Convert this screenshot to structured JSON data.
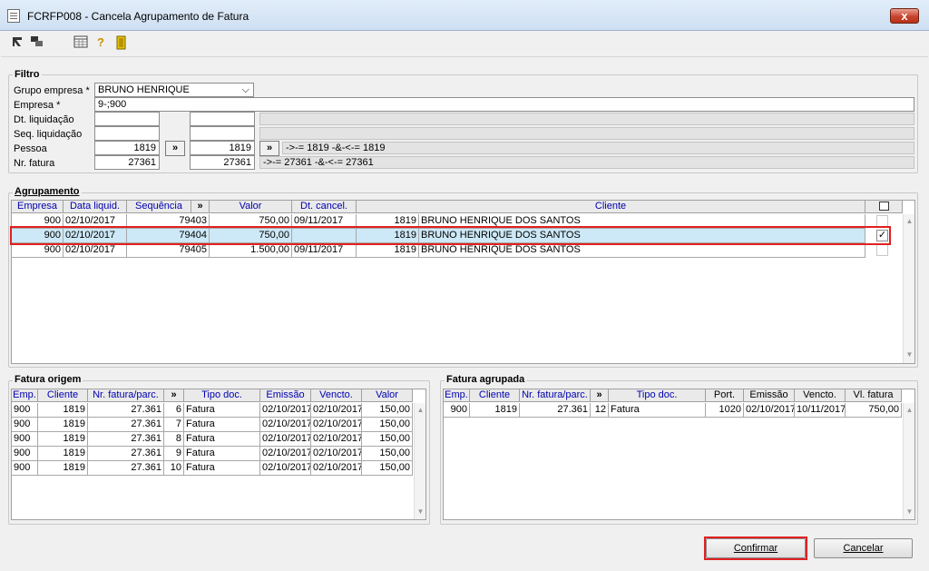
{
  "window": {
    "title": "FCRFP008 - Cancela Agrupamento de Fatura",
    "close_label": "x"
  },
  "toolbar": {
    "icons": [
      "first-icon",
      "navigate-icon",
      "calendar-grid-icon",
      "help-icon",
      "exit-door-icon"
    ],
    "help_glyph": "?"
  },
  "filtro": {
    "title": "Filtro",
    "grupo_label": "Grupo empresa *",
    "grupo_value": "BRUNO HENRIQUE",
    "empresa_label": "Empresa *",
    "empresa_value": "9-;900",
    "dt_label": "Dt. liquidação",
    "seq_label": "Seq. liquidação",
    "pessoa_label": "Pessoa",
    "pessoa_from": "1819",
    "pessoa_to": "1819",
    "pessoa_expr": "->-= 1819 -&-<-= 1819",
    "nr_label": "Nr. fatura",
    "nr_from": "27361",
    "nr_to": "27361",
    "nr_expr": "->-= 27361 -&-<-= 27361",
    "arrow_label": "»"
  },
  "agrupamento": {
    "title": "Agrupamento",
    "headers": [
      "Empresa",
      "Data liquid.",
      "Sequência",
      "»",
      "Valor",
      "Dt. cancel.",
      "Cliente"
    ],
    "rows": [
      {
        "empresa": "900",
        "data": "02/10/2017",
        "seq": "79403",
        "valor": "750,00",
        "dtcancel": "09/11/2017",
        "cli_cod": "1819",
        "cli_nome": "BRUNO HENRIQUE DOS SANTOS",
        "checked": false
      },
      {
        "empresa": "900",
        "data": "02/10/2017",
        "seq": "79404",
        "valor": "750,00",
        "dtcancel": "",
        "cli_cod": "1819",
        "cli_nome": "BRUNO HENRIQUE DOS SANTOS",
        "checked": true
      },
      {
        "empresa": "900",
        "data": "02/10/2017",
        "seq": "79405",
        "valor": "1.500,00",
        "dtcancel": "09/11/2017",
        "cli_cod": "1819",
        "cli_nome": "BRUNO HENRIQUE DOS SANTOS",
        "checked": false
      }
    ],
    "check_mark": "✓"
  },
  "origem": {
    "title": "Fatura origem",
    "headers": [
      "Emp.",
      "Cliente",
      "Nr. fatura/parc.",
      "»",
      "Tipo doc.",
      "Emissão",
      "Vencto.",
      "Valor"
    ],
    "rows": [
      {
        "emp": "900",
        "cliente": "1819",
        "nr": "27.361",
        "parc": "6",
        "tipo": "Fatura",
        "emissao": "02/10/2017",
        "vencto": "02/10/2017",
        "valor": "150,00"
      },
      {
        "emp": "900",
        "cliente": "1819",
        "nr": "27.361",
        "parc": "7",
        "tipo": "Fatura",
        "emissao": "02/10/2017",
        "vencto": "02/10/2017",
        "valor": "150,00"
      },
      {
        "emp": "900",
        "cliente": "1819",
        "nr": "27.361",
        "parc": "8",
        "tipo": "Fatura",
        "emissao": "02/10/2017",
        "vencto": "02/10/2017",
        "valor": "150,00"
      },
      {
        "emp": "900",
        "cliente": "1819",
        "nr": "27.361",
        "parc": "9",
        "tipo": "Fatura",
        "emissao": "02/10/2017",
        "vencto": "02/10/2017",
        "valor": "150,00"
      },
      {
        "emp": "900",
        "cliente": "1819",
        "nr": "27.361",
        "parc": "10",
        "tipo": "Fatura",
        "emissao": "02/10/2017",
        "vencto": "02/10/2017",
        "valor": "150,00"
      }
    ]
  },
  "agrupada": {
    "title": "Fatura agrupada",
    "headers": [
      "Emp.",
      "Cliente",
      "Nr. fatura/parc.",
      "»",
      "Tipo doc.",
      "Port.",
      "Emissão",
      "Vencto.",
      "Vl. fatura"
    ],
    "rows": [
      {
        "emp": "900",
        "cliente": "1819",
        "nr": "27.361",
        "parc": "12",
        "tipo": "Fatura",
        "port": "1020",
        "emissao": "02/10/2017",
        "vencto": "10/11/2017",
        "valor": "750,00"
      }
    ]
  },
  "buttons": {
    "confirmar": "Confirmar",
    "cancelar": "Cancelar"
  },
  "colors": {
    "highlight_row": "#cde8f6",
    "red_outline": "#e02020",
    "header_text": "#0000b0"
  }
}
